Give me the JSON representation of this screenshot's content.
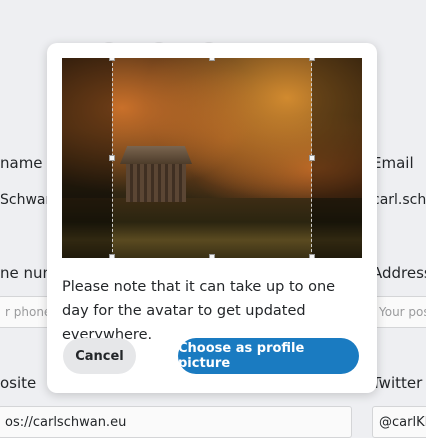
{
  "form": {
    "name_label": "name",
    "name_value": "Schwan",
    "email_label": "Email",
    "email_value": "carl.schw",
    "phone_label": "ne num",
    "phone_placeholder": "r phone",
    "address_label": "Address",
    "address_placeholder": "Your pos",
    "website_label": "osite",
    "website_value": "os://carlschwan.eu",
    "twitter_label": "Twitter",
    "twitter_value": "@carlKD"
  },
  "dialog": {
    "image_name": "autumn-boathouse-photo",
    "note": "Please note that it can take up to one day for the avatar to get updated everywhere.",
    "cancel_label": "Cancel",
    "confirm_label": "Choose as profile picture",
    "accent_color": "#1a7bc1"
  }
}
